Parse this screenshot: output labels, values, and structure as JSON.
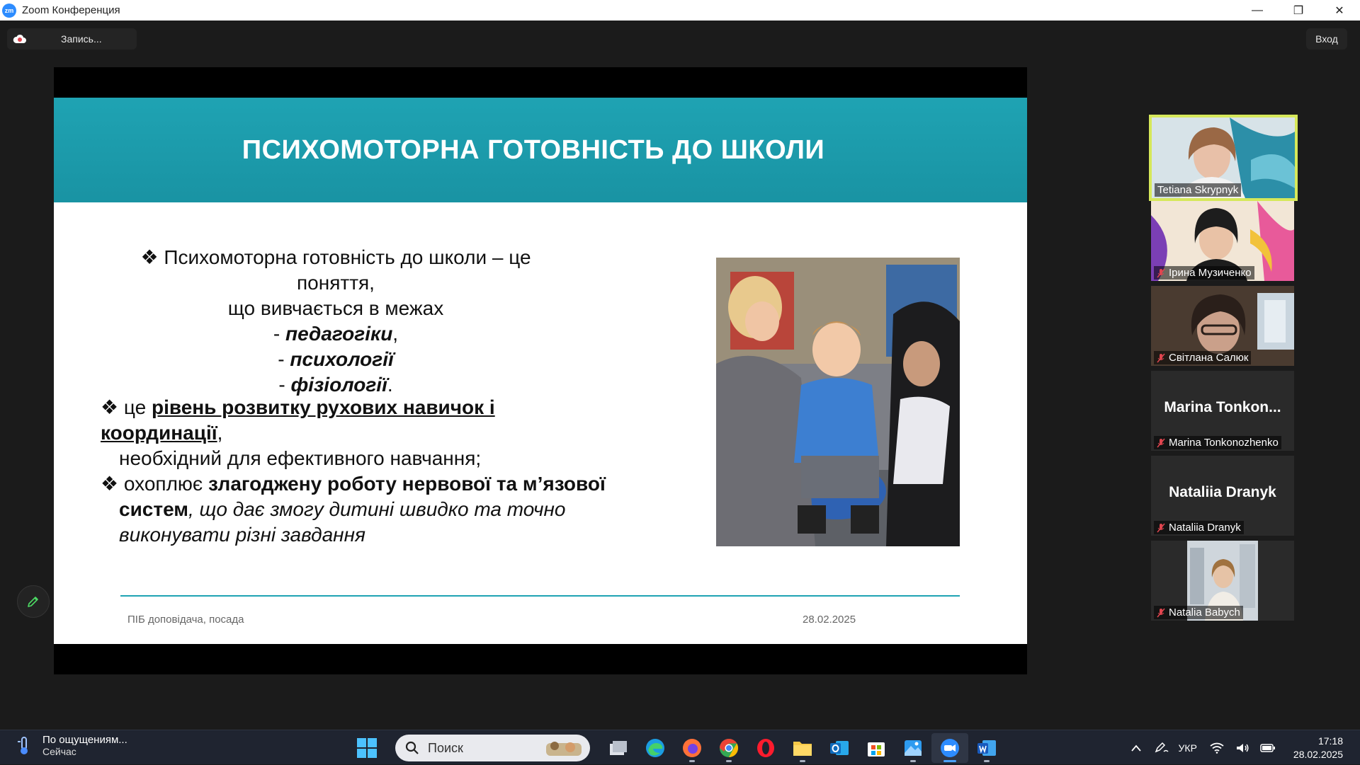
{
  "window": {
    "app_icon_text": "zm",
    "title": "Zoom Конференция",
    "controls": {
      "minimize": "—",
      "restore": "❐",
      "close": "✕"
    }
  },
  "toolbar": {
    "recording_label": "Запись...",
    "signin_label": "Вход"
  },
  "slide": {
    "title": "ПСИХОМОТОРНА ГОТОВНІСТЬ ДО ШКОЛИ",
    "bullet_symbol": "❖",
    "block1": {
      "line1": "Психомоторна готовність до школи – це поняття,",
      "line2": "що вивчається в межах",
      "items": [
        {
          "prefix": "- ",
          "term": "педагогіки",
          "suffix": ","
        },
        {
          "prefix": "- ",
          "term": "психології",
          "suffix": ""
        },
        {
          "prefix": "- ",
          "term": "фізіології",
          "suffix": "."
        }
      ]
    },
    "block2": {
      "b1_prefix": "це ",
      "b1_bold": "рівень розвитку рухових навичок і координації",
      "b1_suffix": ",",
      "b1_line2": "необхідний для ефективного навчання;",
      "b2_prefix": "охоплює ",
      "b2_bold1": "злагоджену роботу нервової та м’язової",
      "b2_bold2": "систем",
      "b2_italic1": ", що дає змогу дитині швидко та точно",
      "b2_italic2": "виконувати різні завдання"
    },
    "footer_left": "ПІБ доповідача, посада",
    "footer_date": "28.02.2025"
  },
  "participants": [
    {
      "name": "Tetiana Skrypnyk",
      "video": true,
      "active": true,
      "muted": false
    },
    {
      "name": "Ірина Музиченко",
      "video": true,
      "active": false,
      "muted": true
    },
    {
      "name": "Світлана Салюк",
      "video": true,
      "active": false,
      "muted": true
    },
    {
      "name": "Marina Tonkonozhenko",
      "display": "Marina Tonkon...",
      "video": false,
      "active": false,
      "muted": true
    },
    {
      "name": "Nataliia Dranyk",
      "display": "Nataliia Dranyk",
      "video": false,
      "active": false,
      "muted": true
    },
    {
      "name": "Natalia Babych",
      "video": true,
      "active": false,
      "muted": true
    }
  ],
  "taskbar": {
    "weather_title": "По ощущениям...",
    "weather_sub": "Сейчас",
    "search_placeholder": "Поиск",
    "apps": [
      "task-view",
      "edge",
      "firefox",
      "chrome",
      "opera",
      "file-explorer",
      "outlook",
      "microsoft-store",
      "photos",
      "zoom",
      "word"
    ],
    "active_app": "zoom",
    "lang": "УКР",
    "time": "17:18",
    "date": "28.02.2025"
  },
  "colors": {
    "slide_header": "#1fa3b3",
    "active_speaker_border": "#d6e85a",
    "muted_mic": "#e0454f",
    "taskbar": "#1f2430"
  }
}
